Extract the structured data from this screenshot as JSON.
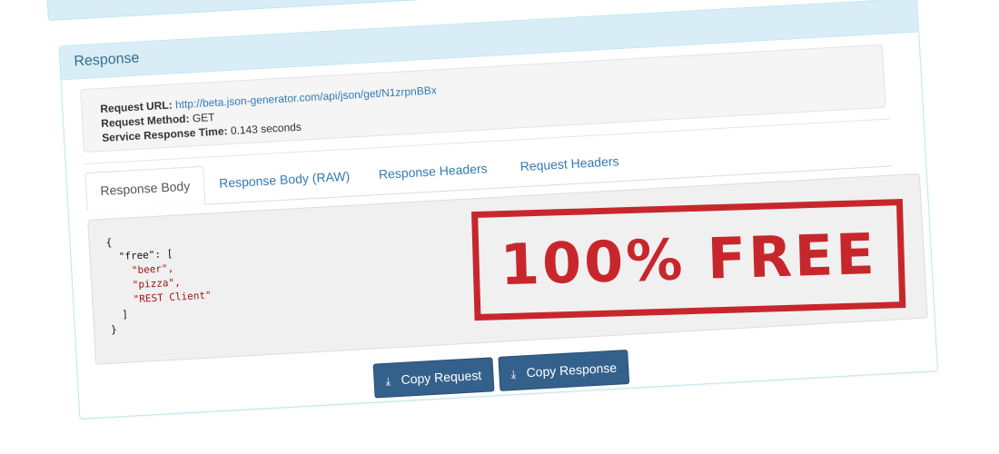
{
  "panel": {
    "title": "Response"
  },
  "request_info": {
    "url_label": "Request URL:",
    "url_value": "http://beta.json-generator.com/api/json/get/N1zrpnBBx",
    "method_label": "Request Method:",
    "method_value": "GET",
    "time_label": "Service Response Time:",
    "time_value": "0.143 seconds"
  },
  "tabs": [
    {
      "label": "Response Body",
      "active": true
    },
    {
      "label": "Response Body (RAW)",
      "active": false
    },
    {
      "label": "Response Headers",
      "active": false
    },
    {
      "label": "Request Headers",
      "active": false
    }
  ],
  "response_body": {
    "lines": [
      "{",
      "  \"free\": [",
      "    \"beer\",",
      "    \"pizza\",",
      "    \"REST Client\"",
      "  ]",
      "}"
    ]
  },
  "stamp": {
    "text": "100% FREE",
    "color": "#c4161c"
  },
  "buttons": {
    "copy_request": "Copy Request",
    "copy_response": "Copy Response",
    "download_icon": "download-icon"
  },
  "colors": {
    "heading_bg": "#d9edf7",
    "heading_text": "#31708f",
    "link": "#337ab7",
    "button_bg": "#34618c"
  }
}
